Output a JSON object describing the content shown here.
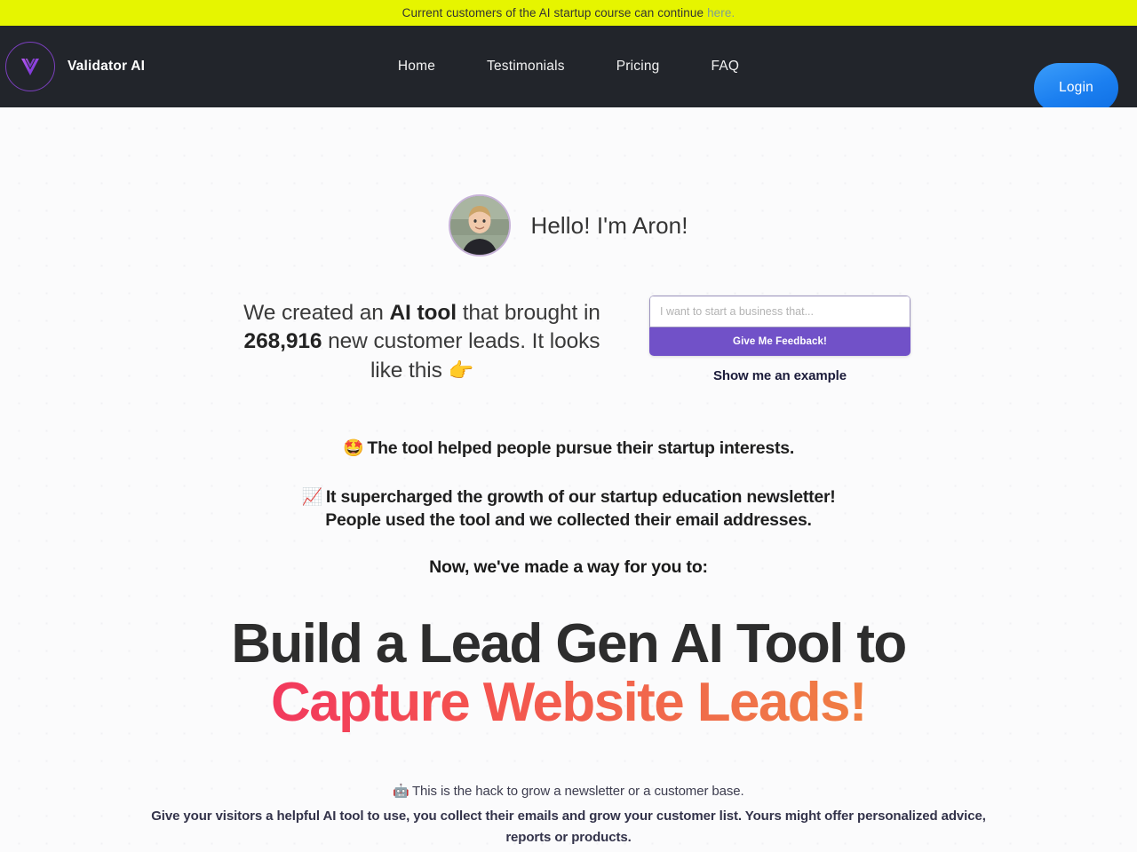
{
  "banner": {
    "text": "Current customers of the AI startup course can continue",
    "link_label": "here.",
    "bg_color": "#e6f500",
    "link_color": "#7d9e93"
  },
  "navbar": {
    "brand_name": "Validator AI",
    "logo_icon": "v-logo-icon",
    "links": [
      {
        "label": "Home"
      },
      {
        "label": "Testimonials"
      },
      {
        "label": "Pricing"
      },
      {
        "label": "FAQ"
      }
    ],
    "login_label": "Login",
    "login_color": "#1b7ff0",
    "bg_color": "#22252b"
  },
  "hero": {
    "avatar_icon": "avatar-photo",
    "greeting": "Hello! I'm Aron!",
    "copy_part1": "We created an ",
    "copy_bold1": "AI tool",
    "copy_part2": " that brought in ",
    "copy_bold2": "268,916",
    "copy_part3": " new customer leads. It looks like this ",
    "point_emoji": "👉",
    "lead_count": "268,916"
  },
  "widget": {
    "input_value": "",
    "input_placeholder": "I want to start a business that...",
    "button_label": "Give Me Feedback!",
    "button_color": "#7151c8",
    "example_label": "Show me an example"
  },
  "benefits": [
    {
      "emoji": "🤩",
      "text": "The tool helped people pursue their startup interests."
    },
    {
      "emoji": "📈",
      "text": "It supercharged the growth of our startup education newsletter!",
      "text_line2": "People used the tool and we collected their email addresses."
    }
  ],
  "transition_line": "Now, we've made a way for you to:",
  "headline": {
    "line1": "Build a Lead Gen AI Tool to",
    "line2": "Capture Website Leads!",
    "gradient_start": "#ec0f79",
    "gradient_end": "#ef9238"
  },
  "footnote": {
    "robot_emoji": "🤖",
    "line1": "This is the hack to grow a newsletter or a customer base.",
    "line2": "Give your visitors a helpful AI tool to use, you collect their emails and grow your customer list. Yours might offer personalized advice, reports or products."
  }
}
